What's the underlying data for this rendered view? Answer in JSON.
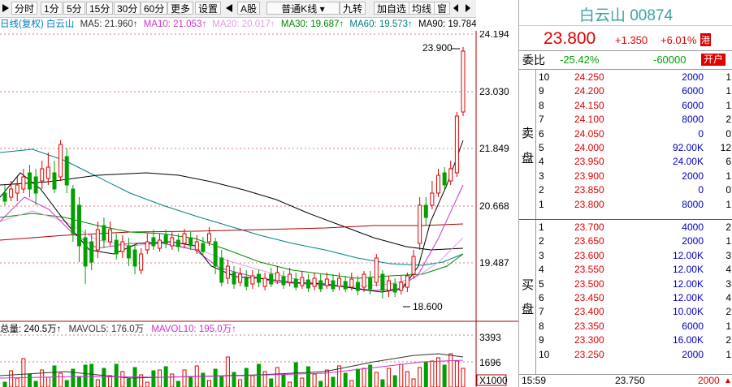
{
  "toolbar": {
    "tabs": [
      "分时",
      "1分",
      "5分",
      "15分",
      "30分",
      "60分",
      "更多",
      "设置"
    ],
    "market": "A股",
    "kline_type": "普通K线",
    "tools": [
      "九转",
      "加自选",
      "均线",
      "窗"
    ]
  },
  "ma_legend": {
    "prefix": "日线(复权) 白云山",
    "ma5": "MA5: 21.960↑",
    "ma10": "MA10: 21.053↑",
    "ma20": "MA20: 20.017↑",
    "ma30": "MA30: 19.687↑",
    "ma60": "MA60: 19.573↑",
    "ma90": "MA90: 19.784",
    "colors": {
      "ma5": "#000000",
      "ma10": "#cc33cc",
      "ma20": "#e0a0e0",
      "ma30": "#008800",
      "ma60": "#008080",
      "ma90": "#000000"
    }
  },
  "volume_legend": {
    "total": "总量: 240.5万↑",
    "mavol5": "MAVOL5: 176.0万",
    "mavol10": "MAVOL10: 195.0万↑"
  },
  "price_axis": [
    "24.194",
    "23.030",
    "21.849",
    "20.668",
    "19.487"
  ],
  "volume_axis": [
    "3393",
    "1696",
    "X1000"
  ],
  "annotations": {
    "high": "23.900",
    "low": "18.600"
  },
  "stock": {
    "name": "白云山",
    "code": "00874",
    "price": "23.800",
    "change": "+1.350",
    "pct": "+6.01%",
    "badge": "港"
  },
  "weibi": {
    "label": "委比",
    "ratio": "-25.42%",
    "diff": "-60000",
    "button": "开户"
  },
  "sell_label": [
    "卖",
    "盘"
  ],
  "buy_label": [
    "买",
    "盘"
  ],
  "asks": [
    {
      "level": "10",
      "price": "24.250",
      "vol": "2000",
      "n": "1"
    },
    {
      "level": "9",
      "price": "24.200",
      "vol": "6000",
      "n": "1"
    },
    {
      "level": "8",
      "price": "24.150",
      "vol": "6000",
      "n": "1"
    },
    {
      "level": "7",
      "price": "24.100",
      "vol": "8000",
      "n": "2"
    },
    {
      "level": "6",
      "price": "24.050",
      "vol": "0",
      "n": "0"
    },
    {
      "level": "5",
      "price": "24.000",
      "vol": "92.00K",
      "n": "12"
    },
    {
      "level": "4",
      "price": "23.950",
      "vol": "24.00K",
      "n": "6"
    },
    {
      "level": "3",
      "price": "23.900",
      "vol": "2000",
      "n": "1"
    },
    {
      "level": "2",
      "price": "23.850",
      "vol": "0",
      "n": "0"
    },
    {
      "level": "1",
      "price": "23.800",
      "vol": "8000",
      "n": "1"
    }
  ],
  "bids": [
    {
      "level": "1",
      "price": "23.700",
      "vol": "4000",
      "n": "2"
    },
    {
      "level": "2",
      "price": "23.650",
      "vol": "2000",
      "n": "1"
    },
    {
      "level": "3",
      "price": "23.600",
      "vol": "12.00K",
      "n": "3"
    },
    {
      "level": "4",
      "price": "23.550",
      "vol": "12.00K",
      "n": "4"
    },
    {
      "level": "5",
      "price": "23.500",
      "vol": "12.00K",
      "n": "3"
    },
    {
      "level": "6",
      "price": "23.450",
      "vol": "12.00K",
      "n": "4"
    },
    {
      "level": "7",
      "price": "23.400",
      "vol": "10.00K",
      "n": "2"
    },
    {
      "level": "8",
      "price": "23.350",
      "vol": "6000",
      "n": "1"
    },
    {
      "level": "9",
      "price": "23.300",
      "vol": "16.00K",
      "n": "2"
    },
    {
      "level": "10",
      "price": "23.250",
      "vol": "2000",
      "n": "1"
    }
  ],
  "last_trade": {
    "time": "15:59",
    "price": "23.750",
    "vol": "2000"
  }
}
